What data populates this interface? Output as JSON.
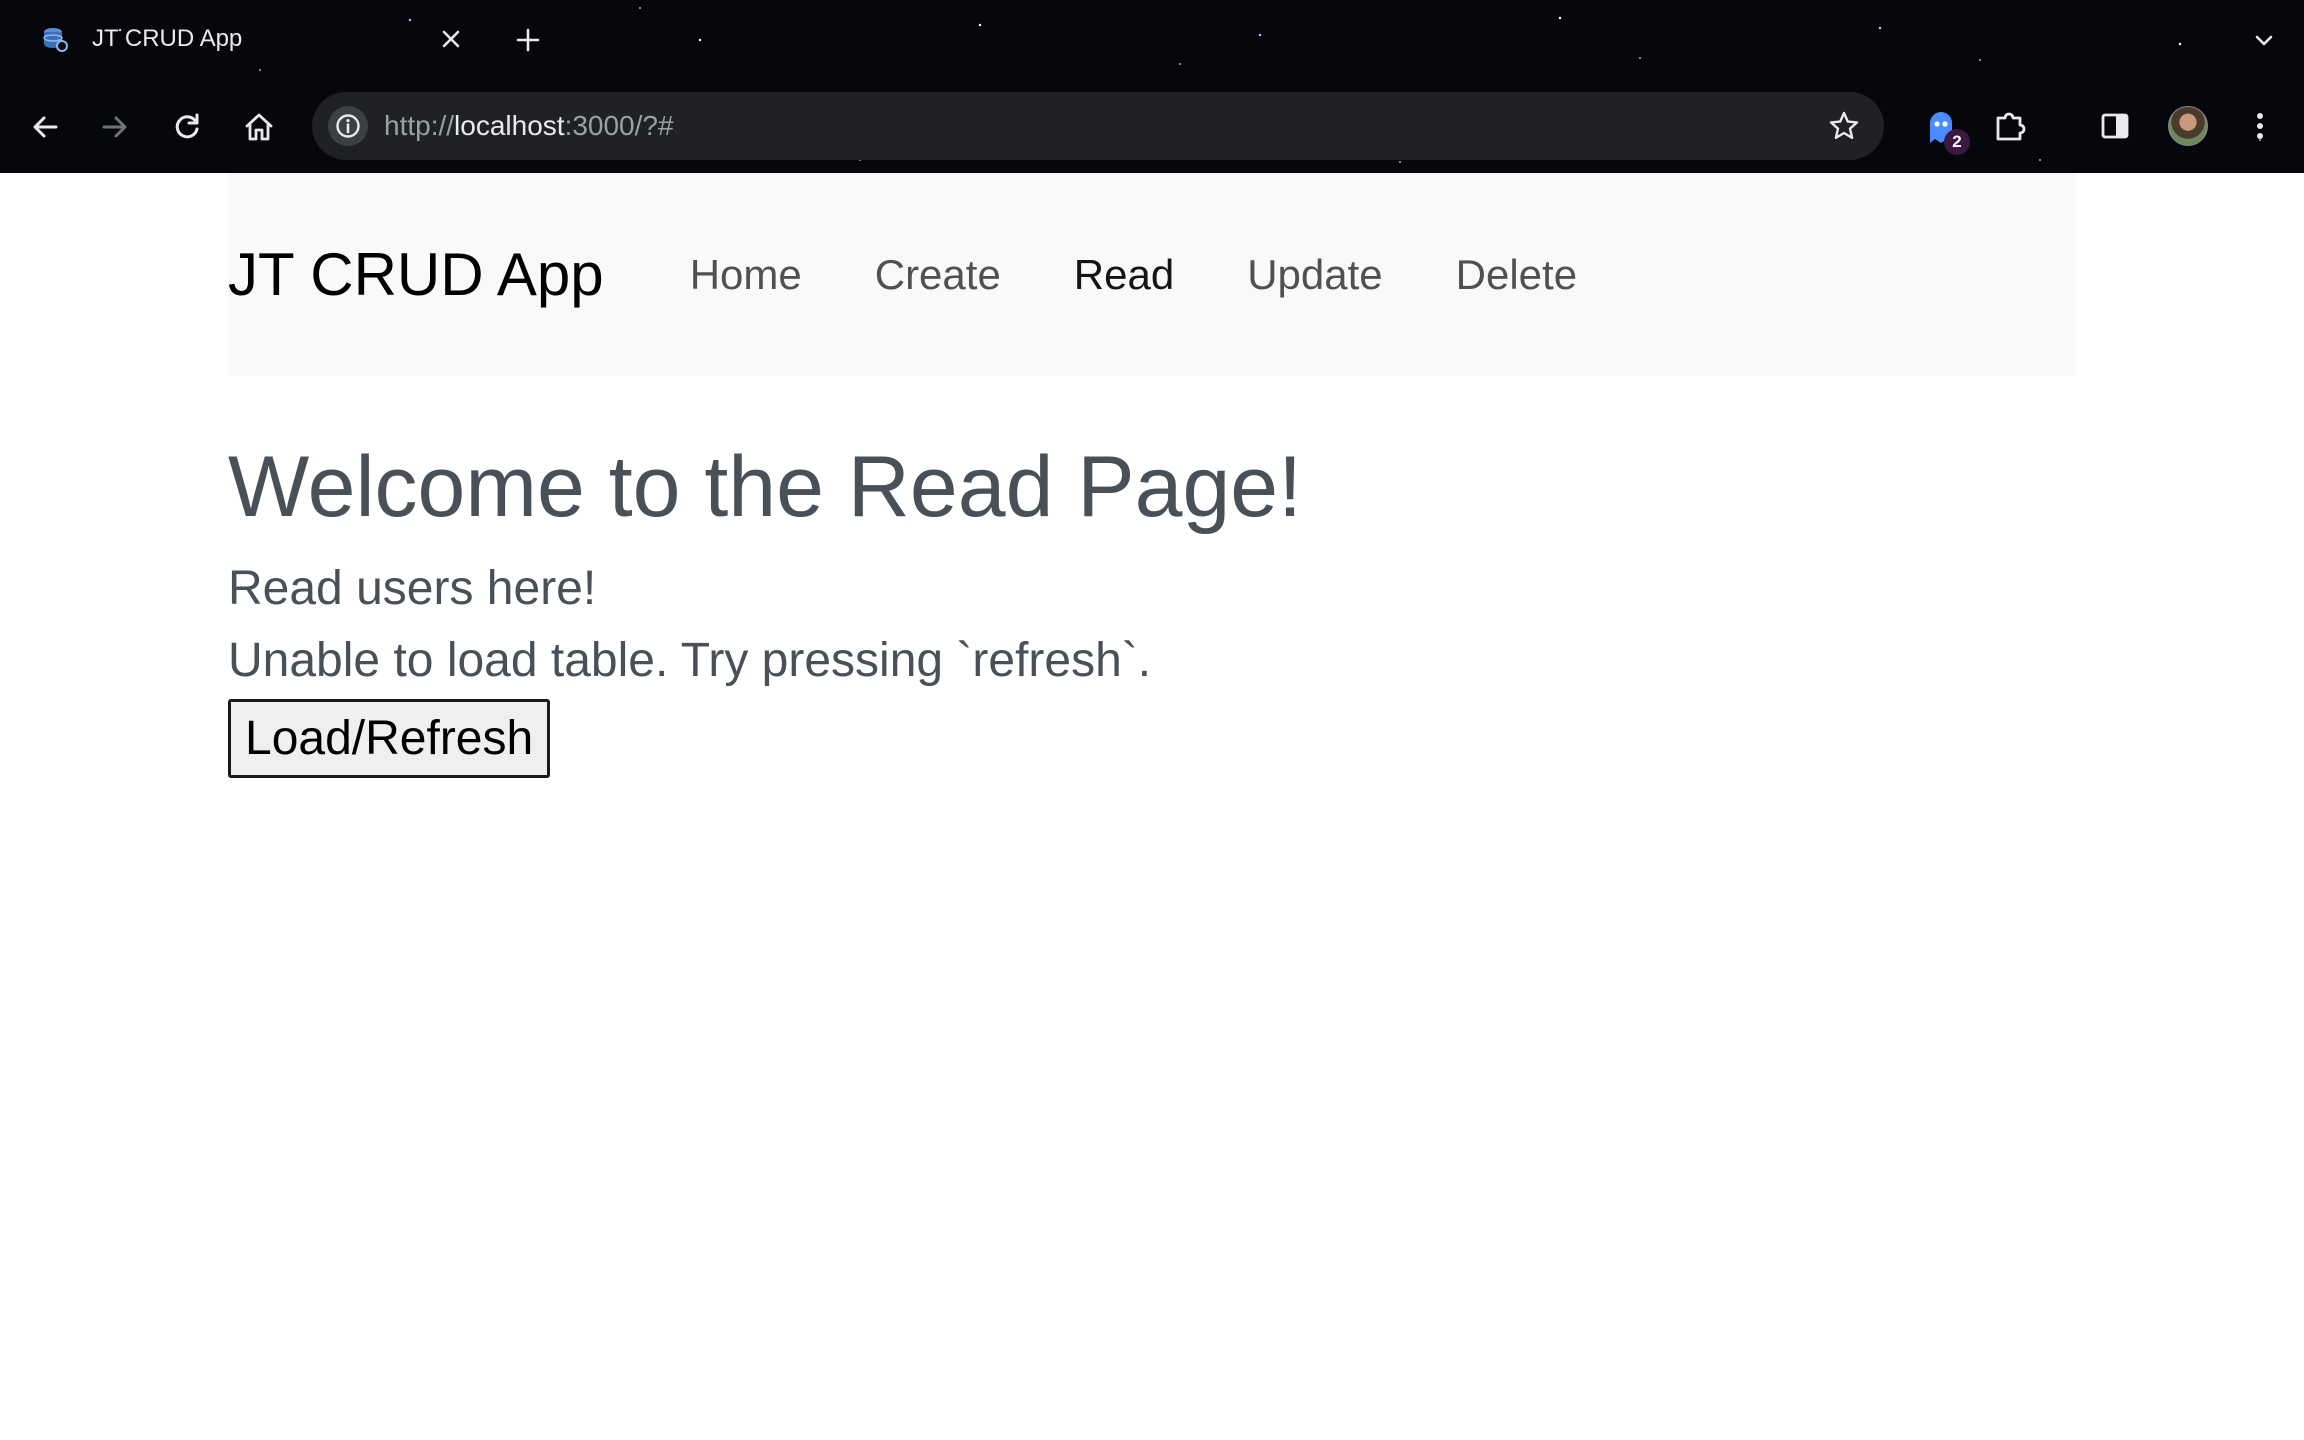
{
  "browser": {
    "tab_title": "JT CRUD App",
    "url_scheme": "http://",
    "url_host": "localhost",
    "url_rest": ":3000/?#",
    "extension_badge_count": "2",
    "icons": {
      "favicon": "database-icon",
      "close": "close-icon",
      "new_tab": "plus-icon",
      "tab_menu": "chevron-down-icon",
      "back": "arrow-left-icon",
      "forward": "arrow-right-icon",
      "reload": "reload-icon",
      "home": "home-icon",
      "site_info": "info-icon",
      "bookmark": "star-icon",
      "extensions": "puzzle-icon",
      "side_panel": "side-panel-icon",
      "menu": "kebab-menu-icon"
    }
  },
  "navbar": {
    "brand": "JT CRUD App",
    "links": [
      {
        "label": "Home",
        "active": false
      },
      {
        "label": "Create",
        "active": false
      },
      {
        "label": "Read",
        "active": true
      },
      {
        "label": "Update",
        "active": false
      },
      {
        "label": "Delete",
        "active": false
      }
    ],
    "background": "#f8f9fa"
  },
  "main": {
    "title": "Welcome to the Read Page!",
    "subtitle": "Read users here!",
    "error_message": "Unable to load table. Try pressing `refresh`.",
    "refresh_button_label": "Load/Refresh",
    "text_color": "#495057"
  }
}
